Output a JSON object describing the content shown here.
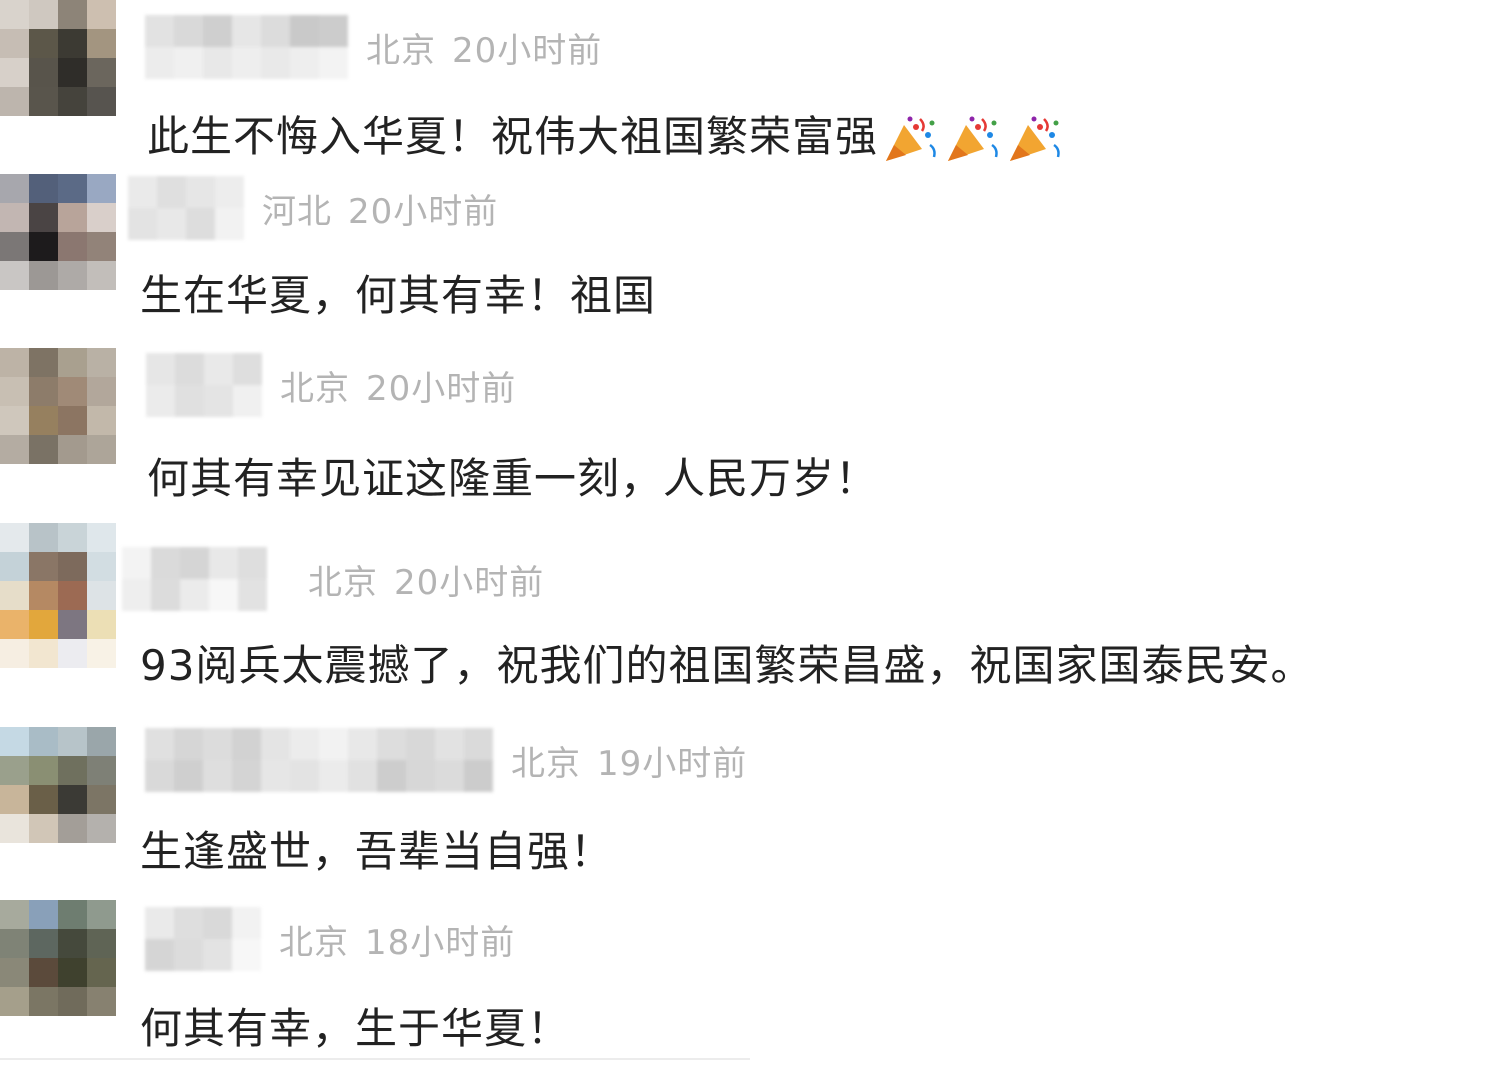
{
  "colors": {
    "meta": "#b4b4b4",
    "text": "#222222"
  },
  "comments": [
    {
      "location": "北京",
      "time": "20小时前",
      "text": "此生不悔入华夏！祝伟大祖国繁荣富强",
      "emojis": [
        "party-popper-icon",
        "party-popper-icon",
        "party-popper-icon"
      ]
    },
    {
      "location": "河北",
      "time": "20小时前",
      "text": "生在华夏，何其有幸！祖国"
    },
    {
      "location": "北京",
      "time": "20小时前",
      "text": "何其有幸见证这隆重一刻，人民万岁！"
    },
    {
      "location": "北京",
      "time": "20小时前",
      "text": "93阅兵太震撼了，祝我们的祖国繁荣昌盛，祝国家国泰民安。"
    },
    {
      "location": "北京",
      "time": "19小时前",
      "text": "生逢盛世，吾辈当自强！"
    },
    {
      "location": "北京",
      "time": "18小时前",
      "text": "何其有幸，生于华夏！"
    }
  ]
}
